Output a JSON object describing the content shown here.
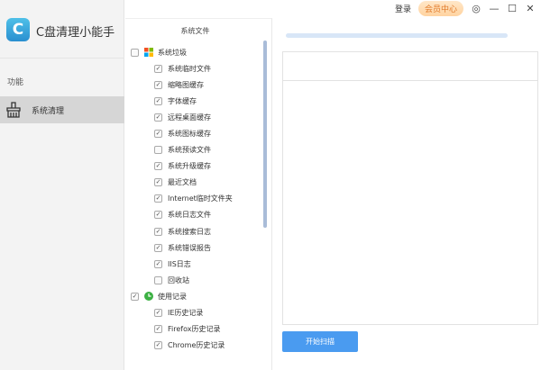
{
  "app": {
    "logo_letter": "C",
    "title": "C盘清理小能手"
  },
  "sidebar": {
    "section": "功能",
    "items": [
      {
        "label": "系统清理",
        "selected": true
      }
    ]
  },
  "topbar": {
    "login": "登录",
    "vip": "会员中心"
  },
  "panel": {
    "title": "系统文件",
    "groups": [
      {
        "label": "系统垃圾",
        "checked": false,
        "icon": "windows-icon",
        "items": [
          {
            "label": "系统临时文件",
            "checked": true
          },
          {
            "label": "缩略图缓存",
            "checked": true
          },
          {
            "label": "字体缓存",
            "checked": true
          },
          {
            "label": "远程桌面缓存",
            "checked": true
          },
          {
            "label": "系统图标缓存",
            "checked": true
          },
          {
            "label": "系统预读文件",
            "checked": false
          },
          {
            "label": "系统升级缓存",
            "checked": true
          },
          {
            "label": "最近文档",
            "checked": true
          },
          {
            "label": "Internet临时文件夹",
            "checked": true
          },
          {
            "label": "系统日志文件",
            "checked": true
          },
          {
            "label": "系统搜索日志",
            "checked": true
          },
          {
            "label": "系统错误报告",
            "checked": true
          },
          {
            "label": "IIS日志",
            "checked": true
          },
          {
            "label": "回收站",
            "checked": false
          }
        ]
      },
      {
        "label": "使用记录",
        "checked": true,
        "icon": "clock-icon",
        "items": [
          {
            "label": "IE历史记录",
            "checked": true
          },
          {
            "label": "Firefox历史记录",
            "checked": true
          },
          {
            "label": "Chrome历史记录",
            "checked": true
          }
        ]
      }
    ]
  },
  "scan": {
    "button": "开始扫描",
    "progress": 0
  }
}
